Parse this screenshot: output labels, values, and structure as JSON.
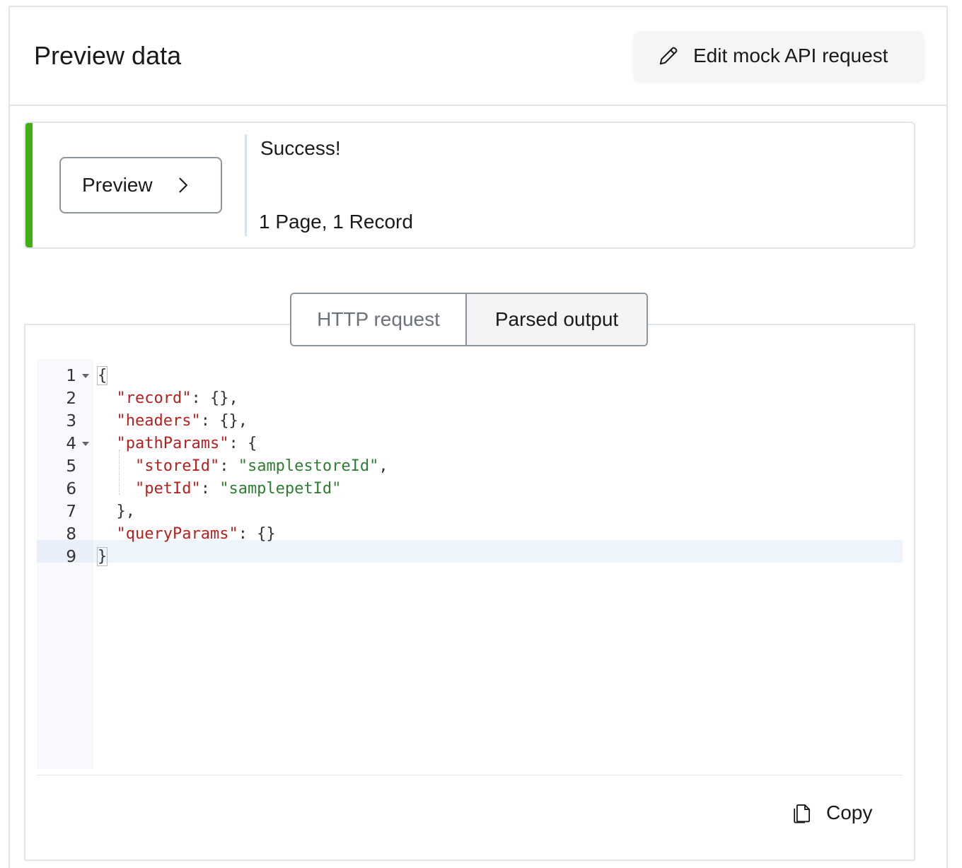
{
  "header": {
    "title": "Preview data",
    "edit_button_label": "Edit mock API request",
    "edit_button_icon": "pencil-icon"
  },
  "result": {
    "preview_button_label": "Preview",
    "preview_button_icon": "chevron-right-icon",
    "status": "Success!",
    "summary": "1 Page, 1 Record",
    "accent_color": "#43b012"
  },
  "tabs": [
    {
      "label": "HTTP request",
      "selected": false
    },
    {
      "label": "Parsed output",
      "selected": true
    }
  ],
  "editor": {
    "lines": [
      {
        "number": "1",
        "foldable": true
      },
      {
        "number": "2",
        "foldable": false
      },
      {
        "number": "3",
        "foldable": false
      },
      {
        "number": "4",
        "foldable": true
      },
      {
        "number": "5",
        "foldable": false
      },
      {
        "number": "6",
        "foldable": false
      },
      {
        "number": "7",
        "foldable": false
      },
      {
        "number": "8",
        "foldable": false
      },
      {
        "number": "9",
        "foldable": false
      }
    ],
    "tokens": {
      "open_brace": "{",
      "close_brace": "}",
      "record_key": "\"record\"",
      "headers_key": "\"headers\"",
      "pathParams_key": "\"pathParams\"",
      "storeId_key": "\"storeId\"",
      "storeId_value": "\"samplestoreId\"",
      "petId_key": "\"petId\"",
      "petId_value": "\"samplepetId\"",
      "queryParams_key": "\"queryParams\"",
      "empty_obj_comma": ": {},",
      "empty_obj": ": {}",
      "colon_open": ": {",
      "colon": ": ",
      "comma": ",",
      "close_comma": "},"
    },
    "key_color": "#b22222",
    "string_color": "#2e7d32"
  },
  "footer": {
    "copy_label": "Copy",
    "copy_icon": "copy-icon"
  }
}
